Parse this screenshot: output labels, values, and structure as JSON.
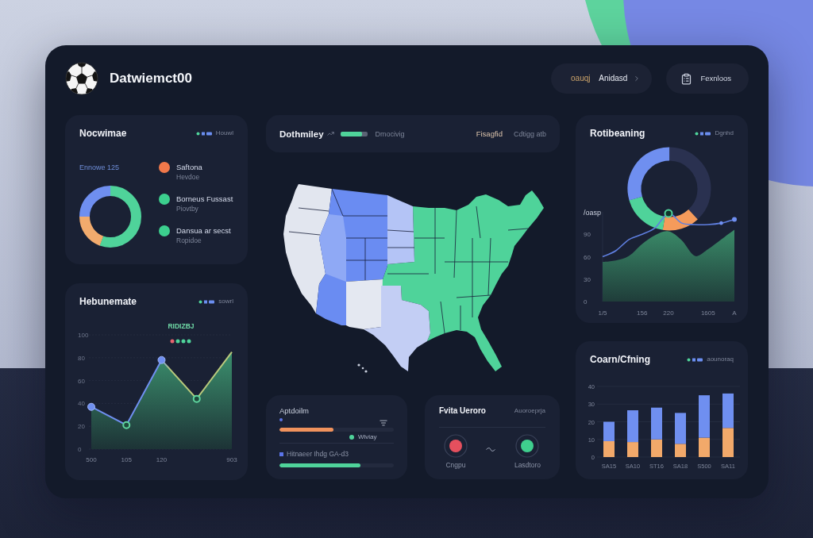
{
  "header": {
    "title": "Datwiemct00",
    "actions": [
      {
        "kind": "menu",
        "tag": "oauqj",
        "label": "Anidasd"
      },
      {
        "kind": "download",
        "label": "Fexnloos"
      }
    ]
  },
  "summary_card": {
    "title": "Nocwimae",
    "legend_label": "Houwl",
    "subtitle": "Ennowe 125",
    "items": [
      {
        "title": "Saftona",
        "subtitle": "Hevdoe",
        "color": "#f0784a"
      },
      {
        "title": "Borneus Fussast",
        "subtitle": "Piovtby",
        "color": "#3ccf8e"
      },
      {
        "title": "Dansua ar secst",
        "subtitle": "Ropidoe",
        "color": "#3ccf8e"
      }
    ]
  },
  "trend_card": {
    "title": "Hebunemate",
    "legend_label": "sowrl",
    "chart_data": {
      "type": "area",
      "title": "RIDIZBJ",
      "grid": true,
      "categories": [
        "500",
        "105",
        "120",
        null,
        "903"
      ],
      "ylim": [
        0,
        100
      ],
      "series": [
        {
          "color": "#3f9c74",
          "values": [
            37,
            21,
            78,
            44,
            85
          ]
        }
      ],
      "yticks": [
        0,
        20,
        40,
        60,
        80,
        100
      ]
    }
  },
  "status_bar": {
    "title": "Dothmiley",
    "level": 0.82,
    "progress_label": "Dmocivig",
    "metric_label": "Fisagfid",
    "metric_value": "Cdtigg atb"
  },
  "progress_card": {
    "title": "Aptdoilm",
    "rows": [
      {
        "kind": "bar",
        "level": 0.47,
        "color": "#f0925c"
      },
      {
        "kind": "marker",
        "label": "Wiviay"
      },
      {
        "kind": "bar",
        "label": "Hitnaeer Ihdg GA-d3",
        "level": 0.71,
        "color": "#4fd39a"
      }
    ]
  },
  "nodes_card": {
    "title": "Fvita Ueroro",
    "subtitle": "Auoroeprja",
    "nodes": [
      {
        "label": "Cngpu",
        "color": "#e5505e"
      },
      {
        "label": "Lasdtoro",
        "color": "#3fcf8e"
      }
    ]
  },
  "rotation_card": {
    "title": "Rotibeaning",
    "legend_label": "Dgnhd",
    "chart_data": {
      "type": "area",
      "ylabel": "/oasp",
      "categories": [
        "1/5",
        null,
        null,
        "156",
        null,
        "220",
        null,
        null,
        "1605",
        null,
        "A"
      ],
      "ylim": [
        0,
        120
      ],
      "series": [
        {
          "type": "area",
          "color": "#3a8a68",
          "values": [
            53,
            55,
            61,
            77,
            89,
            94,
            82,
            61,
            70,
            83,
            96
          ]
        },
        {
          "type": "line",
          "color": "#5f7fe0",
          "values": [
            60,
            68,
            83,
            90,
            99,
            118,
            105,
            103,
            103,
            105,
            110
          ]
        }
      ],
      "yticks": [
        0,
        30,
        60,
        90
      ]
    }
  },
  "bars_card": {
    "title": "Coarn/Cfning",
    "legend_label": "aounoraq",
    "chart_data": {
      "type": "bar",
      "stacked": true,
      "grid": true,
      "categories": [
        "SA15",
        "SA10",
        "ST16",
        "SA18",
        "S500",
        "SA11"
      ],
      "ylim": [
        0,
        40
      ],
      "series": [
        {
          "color": "#f2a96a",
          "values": [
            9,
            8.5,
            10,
            7.5,
            11,
            16.5
          ]
        },
        {
          "color": "#6f8ff0",
          "values": [
            11,
            18,
            18,
            17.5,
            24,
            19.5
          ]
        }
      ],
      "yticks": [
        0,
        10,
        20,
        30,
        40
      ]
    }
  }
}
